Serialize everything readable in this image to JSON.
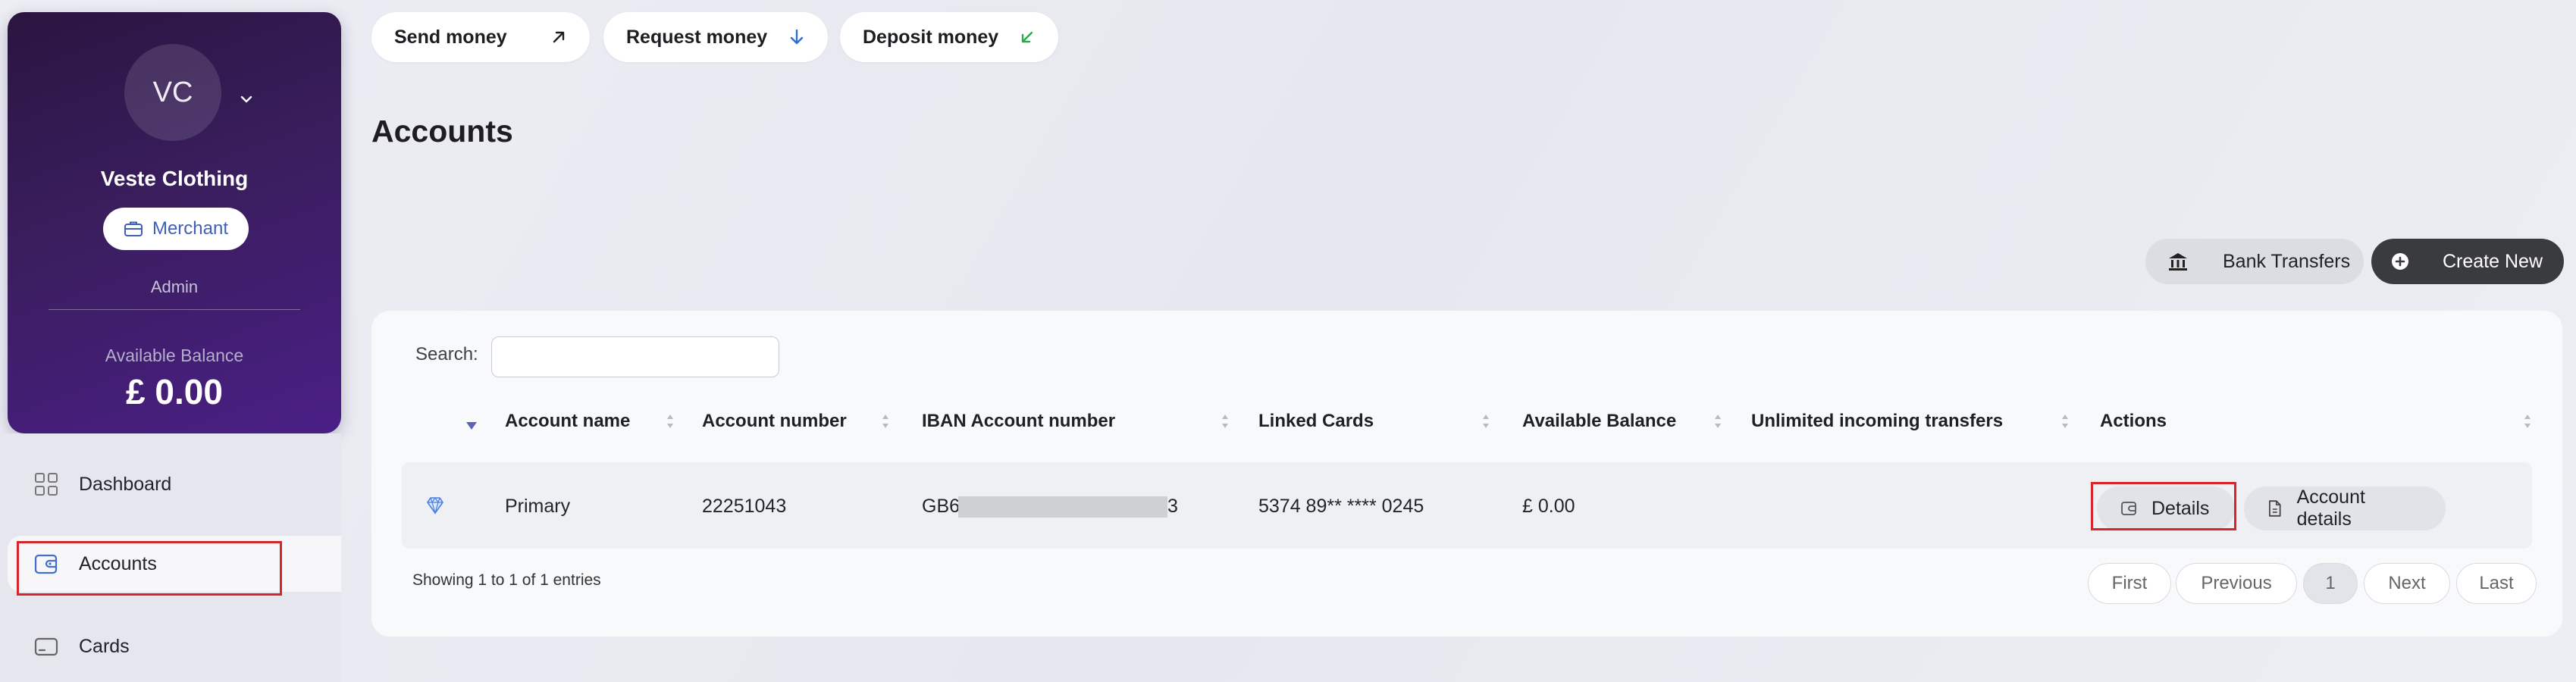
{
  "profile": {
    "initials": "VC",
    "company": "Veste Clothing",
    "badge": "Merchant",
    "role": "Admin",
    "balance_label": "Available Balance",
    "balance_value": "£ 0.00"
  },
  "sidebar": {
    "items": [
      {
        "label": "Dashboard",
        "icon": "dashboard-grid-icon"
      },
      {
        "label": "Accounts",
        "icon": "wallet-icon",
        "active": true
      },
      {
        "label": "Cards",
        "icon": "card-icon"
      }
    ]
  },
  "actions": {
    "send": "Send money",
    "request": "Request money",
    "deposit": "Deposit money"
  },
  "page": {
    "title": "Accounts",
    "bank_transfers": "Bank Transfers",
    "create_new": "Create New"
  },
  "table": {
    "search_label": "Search:",
    "search_value": "",
    "columns": [
      "Account name",
      "Account number",
      "IBAN Account number",
      "Linked Cards",
      "Available Balance",
      "Unlimited incoming transfers",
      "Actions"
    ],
    "rows": [
      {
        "icon": "diamond-icon",
        "account_name": "Primary",
        "account_number": "22251043",
        "iban_prefix": "GB6",
        "iban_suffix": "3",
        "linked_cards": "5374 89** **** 0245",
        "available_balance": "£ 0.00",
        "unlimited_incoming": "",
        "actions": {
          "details": "Details",
          "account_details": "Account details"
        }
      }
    ],
    "showing": "Showing 1 to 1 of 1 entries",
    "pagination": {
      "first": "First",
      "previous": "Previous",
      "current": "1",
      "next": "Next",
      "last": "Last"
    }
  },
  "colors": {
    "accent_red": "#d6262c",
    "card_gradient_start": "#2a1540",
    "card_gradient_end": "#4a1f86",
    "dark_button": "#3a3b3f"
  }
}
